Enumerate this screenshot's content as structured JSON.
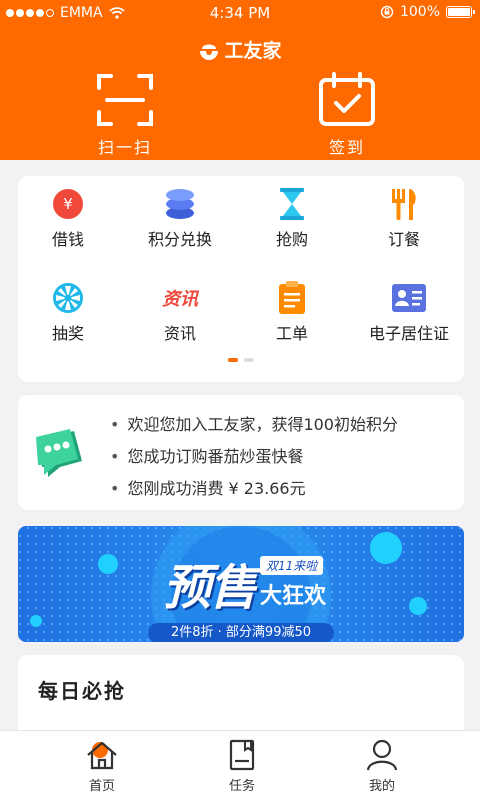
{
  "status_bar": {
    "carrier": "EMMA",
    "time": "4:34 PM",
    "battery": "100%",
    "signal_dots": 4
  },
  "header": {
    "brand": "工友家",
    "scan_label": "扫一扫",
    "sign_label": "签到",
    "background_color": "#ff6a00"
  },
  "menu": {
    "items": [
      {
        "label": "借钱",
        "icon": "yuan-coin-icon"
      },
      {
        "label": "积分兑换",
        "icon": "database-icon"
      },
      {
        "label": "抢购",
        "icon": "hourglass-icon"
      },
      {
        "label": "订餐",
        "icon": "fork-knife-icon"
      },
      {
        "label": "抽奖",
        "icon": "fan-icon"
      },
      {
        "label": "资讯",
        "icon": "news-icon",
        "icon_text": "资讯"
      },
      {
        "label": "工单",
        "icon": "clipboard-icon"
      },
      {
        "label": "电子居住证",
        "icon": "id-card-icon"
      }
    ],
    "page_count": 2,
    "active_page": 1
  },
  "news": {
    "items": [
      "欢迎您加入工友家，获得100初始积分",
      "您成功订购番茄炒蛋快餐",
      "您刚成功消费 ¥ 23.66元"
    ]
  },
  "banner": {
    "title_main": "预售",
    "title_tag": "双11来啦",
    "title_sub": "大狂欢",
    "promo_text": "2件8折 · 部分满99减50"
  },
  "daily": {
    "title": "每日必抢"
  },
  "tabbar": {
    "home": "首页",
    "task": "任务",
    "mine": "我的"
  }
}
